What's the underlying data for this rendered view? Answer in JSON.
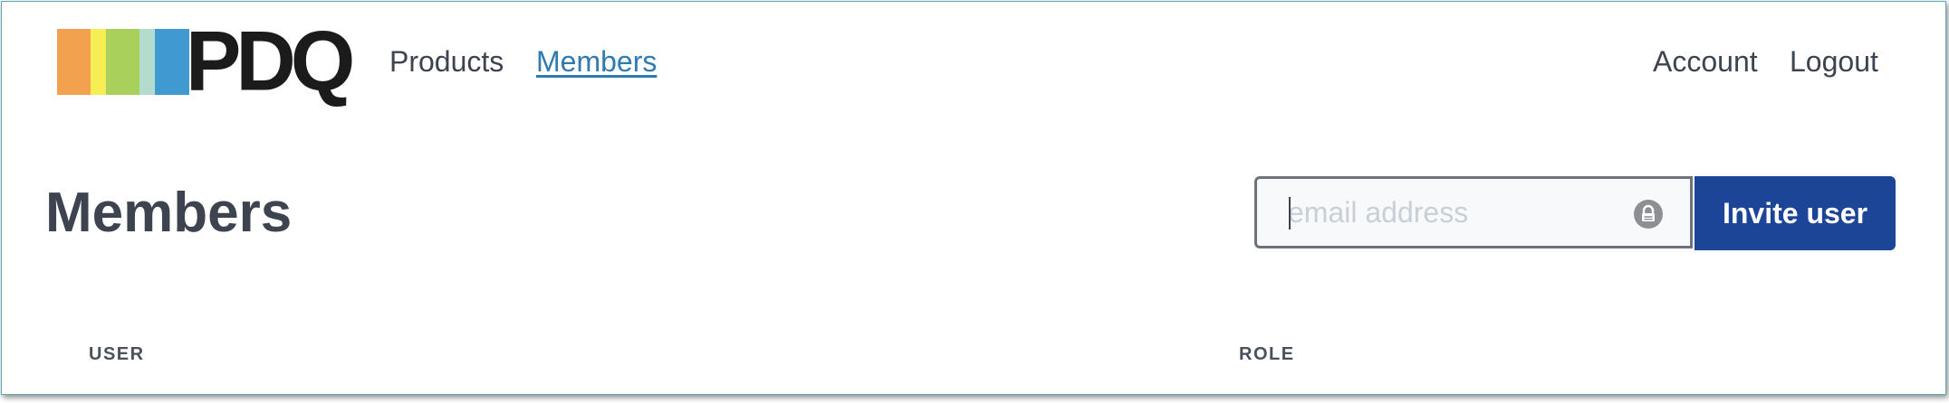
{
  "header": {
    "logo_text": "PDQ",
    "logo_stripes": [
      "#f2a24f",
      "#f7ee56",
      "#a8d05a",
      "#b3dccf",
      "#4199d2"
    ],
    "nav": [
      {
        "label": "Products",
        "active": false
      },
      {
        "label": "Members",
        "active": true
      }
    ],
    "account_label": "Account",
    "logout_label": "Logout"
  },
  "main": {
    "title": "Members",
    "invite": {
      "email_placeholder": "email address",
      "email_value": "",
      "button_label": "Invite user"
    },
    "table": {
      "columns": [
        "USER",
        "ROLE"
      ]
    }
  },
  "colors": {
    "accent_link": "#2f7ab0",
    "button_bg": "#1c4597",
    "text": "#3d4450",
    "frame_border": "#5fa9b3"
  }
}
